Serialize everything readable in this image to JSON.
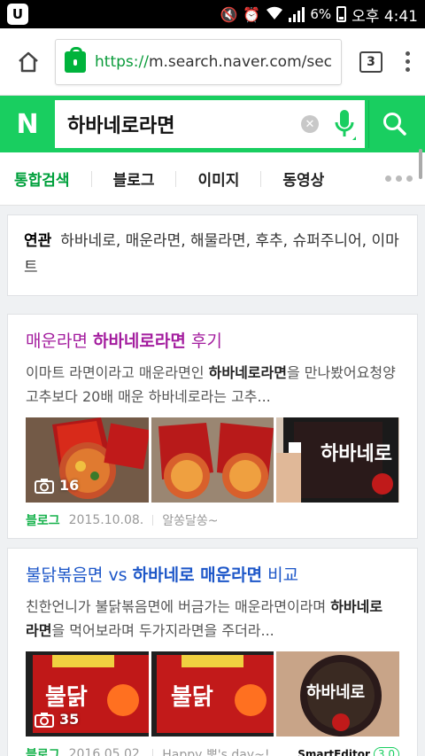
{
  "status": {
    "battery": "6%",
    "time": "오후 4:41",
    "app_icon": "U"
  },
  "browser": {
    "url_scheme": "https://",
    "url_rest": "m.search.naver.com/sec",
    "tab_count": "3"
  },
  "search": {
    "logo": "N",
    "query": "하바네로라면"
  },
  "tabs": [
    "통합검색",
    "블로그",
    "이미지",
    "동영상"
  ],
  "related": {
    "label": "연관",
    "text": "하바네로, 매운라면, 해물라면, 후추, 슈퍼주니어, 이마트"
  },
  "results": [
    {
      "title_pre": "매운라면 ",
      "title_em": "하바네로라면",
      "title_post": " 후기",
      "desc_a": "이마트 라면이라고 매운라면인 ",
      "desc_em": "하바네로라면",
      "desc_b": "을 만나봤어요청양고추보다 20배 매운 하바네로라는 고추...",
      "photo_count": "16",
      "source": "블로그",
      "date": "2015.10.08.",
      "author": "알쏭달쏭~"
    },
    {
      "title_pre": "불닭볶음면 vs ",
      "title_em": "하바네로 매운라면",
      "title_post": " 비교",
      "desc_a": "친한언니가 불닭볶음면에 버금가는 매운라면이라며 ",
      "desc_em": "하바네로 라면",
      "desc_b": "을 먹어보라며 두가지라면을 주더라...",
      "photo_count": "35",
      "source": "블로그",
      "date": "2016.05.02.",
      "author": "Happy 뽀's day~!",
      "editor_badge": "SmartEditor",
      "editor_version": "3.0"
    }
  ],
  "colors": {
    "naver_green": "#19ce60",
    "visited": "#a31c9e",
    "link": "#1c56c8"
  }
}
